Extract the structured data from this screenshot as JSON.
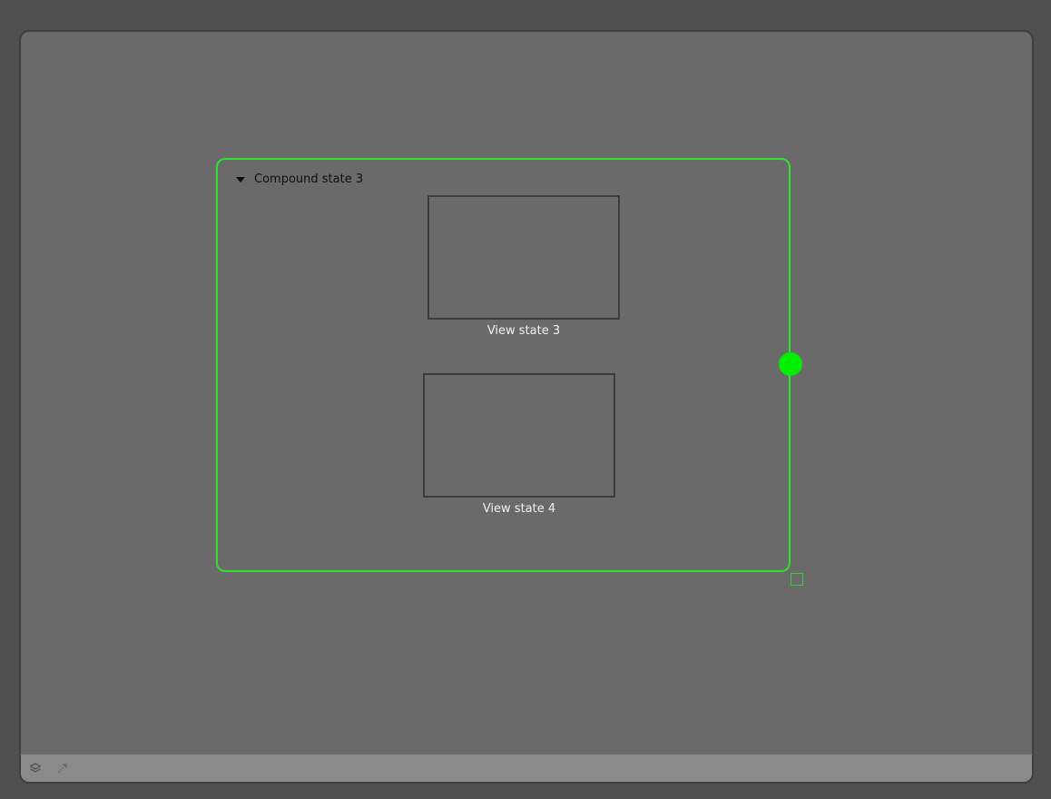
{
  "compound_state": {
    "title": "Compound state 3",
    "expanded": true,
    "border_color": "#2fe02f"
  },
  "view_states": [
    {
      "label": "View state 3"
    },
    {
      "label": "View state 4"
    }
  ],
  "bottom_bar": {
    "icons": [
      "layers-icon",
      "arrow-up-right-icon"
    ]
  },
  "colors": {
    "canvas_bg": "#6a6a6a",
    "outer_bg": "#505050",
    "bottom_bar_bg": "#8a8a8a",
    "selection_handle": "#00ee00"
  }
}
